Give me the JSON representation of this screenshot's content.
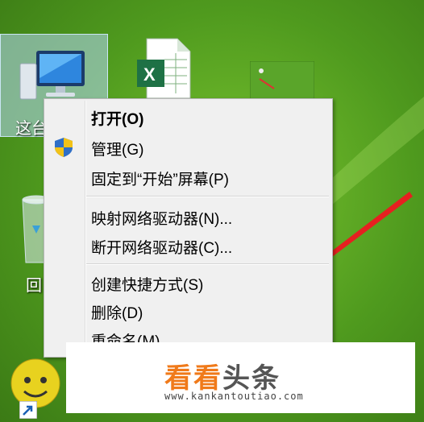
{
  "desktop": {
    "icons": [
      {
        "label": "这台",
        "icon": "computer-icon"
      },
      {
        "label": "",
        "icon": "excel-file-icon"
      },
      {
        "label": "",
        "icon": "image-file-icon"
      },
      {
        "label": "回",
        "icon": "recycle-bin-icon"
      },
      {
        "label": "",
        "icon": "shortcut-arrow-icon"
      }
    ]
  },
  "context_menu": {
    "items": [
      {
        "label": "打开(O)",
        "bold": true
      },
      {
        "label": "管理(G)",
        "icon": "uac-shield-icon"
      },
      {
        "label": "固定到“开始”屏幕(P)"
      },
      {
        "label": "映射网络驱动器(N)..."
      },
      {
        "label": "断开网络驱动器(C)..."
      },
      {
        "label": "创建快捷方式(S)"
      },
      {
        "label": "删除(D)"
      },
      {
        "label": "重命名(M)"
      }
    ]
  },
  "watermark": {
    "brand_part1": "看看",
    "brand_part2": "头条",
    "url": "www.kankantoutiao.com"
  },
  "colors": {
    "desktop_green": "#4f9a1e",
    "menu_bg": "#f0f0f0",
    "brand_orange": "#f07a1a",
    "arrow_red": "#e62020"
  }
}
